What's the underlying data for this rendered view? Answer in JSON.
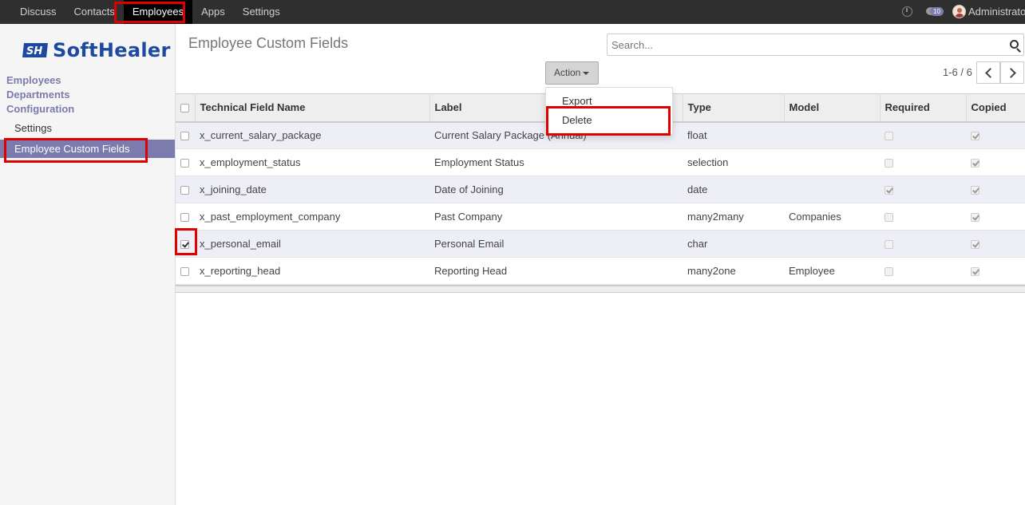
{
  "topbar": {
    "menu": [
      "Discuss",
      "Contacts",
      "Employees",
      "Apps",
      "Settings"
    ],
    "active": "Employees",
    "message_count": "10",
    "user": "Administrator"
  },
  "sidebar": {
    "brand": "SoftHealer",
    "headings": [
      "Employees",
      "Departments",
      "Configuration"
    ],
    "items": [
      "Settings",
      "Employee Custom Fields"
    ]
  },
  "control": {
    "title": "Employee Custom Fields",
    "search_placeholder": "Search...",
    "action_label": "Action",
    "pager": "1-6 / 6"
  },
  "action_menu": [
    "Export",
    "Delete"
  ],
  "table": {
    "columns": [
      "Technical Field Name",
      "Label",
      "Type",
      "Model",
      "Required",
      "Copied"
    ],
    "rows": [
      {
        "name": "x_current_salary_package",
        "label": "Current Salary Package (Annual)",
        "type": "float",
        "model": "",
        "required": false,
        "copied": true,
        "selected": false
      },
      {
        "name": "x_employment_status",
        "label": "Employment Status",
        "type": "selection",
        "model": "",
        "required": false,
        "copied": true,
        "selected": false
      },
      {
        "name": "x_joining_date",
        "label": "Date of Joining",
        "type": "date",
        "model": "",
        "required": true,
        "copied": true,
        "selected": false
      },
      {
        "name": "x_past_employment_company",
        "label": "Past Company",
        "type": "many2many",
        "model": "Companies",
        "required": false,
        "copied": true,
        "selected": false
      },
      {
        "name": "x_personal_email",
        "label": "Personal Email",
        "type": "char",
        "model": "",
        "required": false,
        "copied": true,
        "selected": true
      },
      {
        "name": "x_reporting_head",
        "label": "Reporting Head",
        "type": "many2one",
        "model": "Employee",
        "required": false,
        "copied": true,
        "selected": false
      }
    ]
  },
  "colors": {
    "accent": "#7c7bad",
    "highlight": "#e00000",
    "topbar": "#2f2f2f"
  }
}
